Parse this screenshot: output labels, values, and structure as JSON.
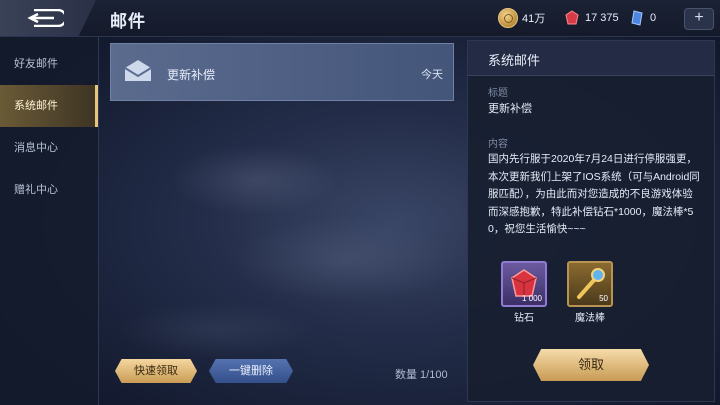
{
  "header": {
    "title": "邮件",
    "currency": [
      {
        "icon": "coin-icon",
        "value": "41万"
      },
      {
        "icon": "gem-icon",
        "value": "17 375"
      },
      {
        "icon": "crystal-icon",
        "value": "0"
      }
    ],
    "plus_label": "+"
  },
  "sidebar": {
    "items": [
      {
        "label": "好友邮件"
      },
      {
        "label": "系统邮件",
        "active": true
      },
      {
        "label": "消息中心"
      },
      {
        "label": "赠礼中心"
      }
    ]
  },
  "mail_list": [
    {
      "icon": "envelope-icon",
      "title": "更新补偿",
      "date": "今天"
    }
  ],
  "bottom": {
    "quick_claim": "快速领取",
    "delete_all": "一键删除",
    "count": "数量 1/100"
  },
  "detail": {
    "title": "系统邮件",
    "subject_label": "标题",
    "subject": "更新补偿",
    "content_label": "内容",
    "content": "国内先行服于2020年7月24日进行停服强更，本次更新我们上架了IOS系统（可与Android同服匹配），为由此而对您造成的不良游戏体验而深感抱歉，特此补偿钻石*1000，魔法棒*50，祝您生活愉快~~~",
    "rewards": [
      {
        "name": "钻石",
        "qty": "1 000",
        "icon": "diamond-icon"
      },
      {
        "name": "魔法棒",
        "qty": "50",
        "icon": "magic-wand-icon"
      }
    ],
    "claim_label": "领取"
  },
  "colors": {
    "accent_gold": "#e7c57a",
    "panel": "#171e30",
    "mail_row": "#4e5f84"
  }
}
